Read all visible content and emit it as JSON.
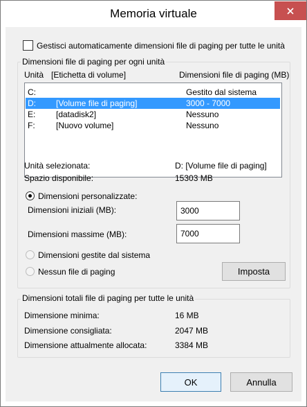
{
  "window": {
    "title": "Memoria virtuale"
  },
  "auto_manage": {
    "label": "Gestisci automaticamente dimensioni file di paging per tutte le unità",
    "checked": false
  },
  "drives_group": {
    "title": "Dimensioni file di paging per ogni unità",
    "header_drive": "Unità",
    "header_label": "[Etichetta di volume]",
    "header_size": "Dimensioni file di paging (MB)",
    "rows": [
      {
        "drive": "C:",
        "label": "",
        "size": "Gestito dal sistema",
        "selected": false
      },
      {
        "drive": "D:",
        "label": "[Volume file di paging]",
        "size": "3000 - 7000",
        "selected": true
      },
      {
        "drive": "E:",
        "label": "[datadisk2]",
        "size": "Nessuno",
        "selected": false
      },
      {
        "drive": "F:",
        "label": "[Nuovo volume]",
        "size": "Nessuno",
        "selected": false
      }
    ],
    "selected_drive_label": "Unità selezionata:",
    "selected_drive_value": "D:  [Volume file di paging]",
    "free_space_label": "Spazio disponibile:",
    "free_space_value": "15303 MB",
    "custom_size_label": "Dimensioni personalizzate:",
    "initial_size_label": "Dimensioni iniziali (MB):",
    "initial_size_value": "3000",
    "max_size_label": "Dimensioni massime (MB):",
    "max_size_value": "7000",
    "system_managed_label": "Dimensioni gestite dal sistema",
    "no_paging_label": "Nessun file di paging",
    "set_button": "Imposta"
  },
  "totals_group": {
    "title": "Dimensioni totali file di paging per tutte le unità",
    "min_label": "Dimensione minima:",
    "min_value": "16 MB",
    "recommended_label": "Dimensione consigliata:",
    "recommended_value": "2047 MB",
    "allocated_label": "Dimensione attualmente allocata:",
    "allocated_value": "3384 MB"
  },
  "buttons": {
    "ok": "OK",
    "cancel": "Annulla"
  },
  "colors": {
    "selection": "#3399ff",
    "close_button": "#c75050",
    "dialog_bg": "#f0f0f0"
  }
}
